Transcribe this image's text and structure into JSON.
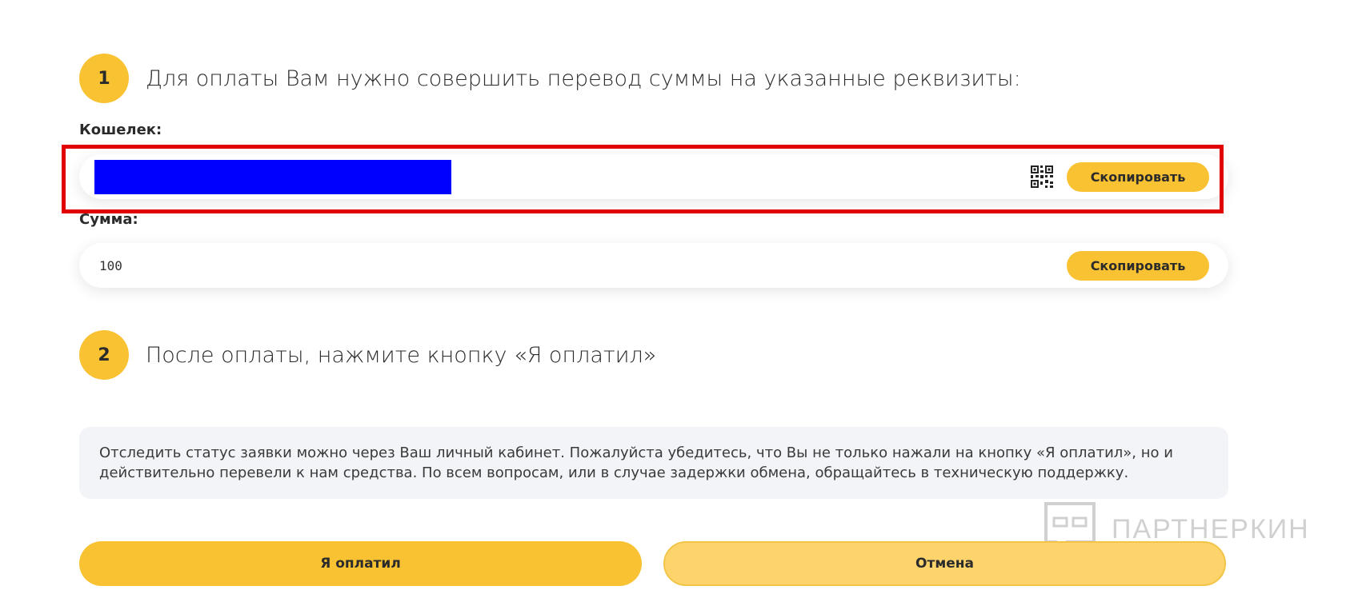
{
  "steps": [
    {
      "number": "1",
      "text": "Для оплаты Вам нужно совершить перевод суммы на указанные реквизиты:"
    },
    {
      "number": "2",
      "text": "После оплаты, нажмите кнопку «Я оплатил»"
    }
  ],
  "wallet": {
    "label": "Кошелек:",
    "value": "",
    "copy_label": "Скопировать",
    "qr_icon": "qr-code-icon"
  },
  "amount": {
    "label": "Сумма:",
    "value": "100",
    "copy_label": "Скопировать"
  },
  "notice": {
    "text": "Отследить статус заявки можно через Ваш личный кабинет. Пожалуйста убедитесь, что Вы не только нажали на кнопку «Я оплатил», но и действительно перевели к нам средства. По всем вопросам, или в случае задержки обмена, обращайтесь в техническую поддержку."
  },
  "actions": {
    "paid_label": "Я оплатил",
    "cancel_label": "Отмена"
  },
  "watermark": {
    "text": "ПАРТНЕРКИН"
  },
  "colors": {
    "accent": "#f9c232",
    "cancel_bg": "#fdd36b",
    "highlight": "#e00000",
    "redaction": "#0000ff",
    "notice_bg": "#f3f4f8"
  }
}
